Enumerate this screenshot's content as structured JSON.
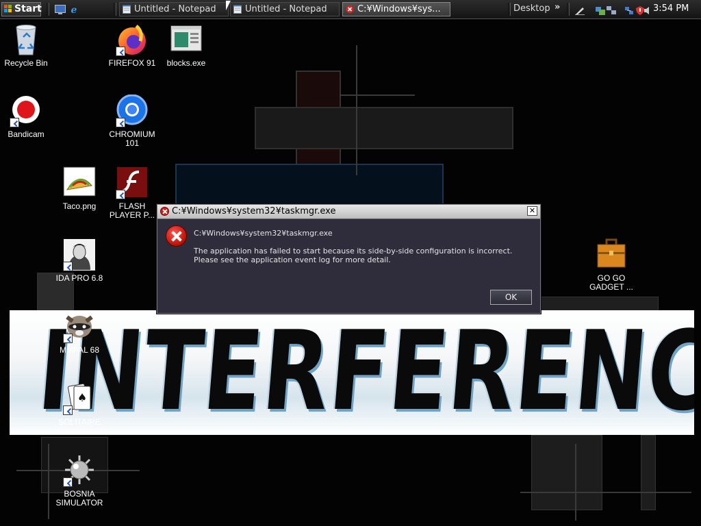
{
  "taskbar": {
    "start_label": "Start",
    "tasks": [
      {
        "label": "Untitled - Notepad",
        "active": false
      },
      {
        "label": "Untitled - Notepad",
        "active": false
      },
      {
        "label": "C:¥Windows¥sys...",
        "active": true
      }
    ],
    "desktop_toolbar_label": "Desktop",
    "chevron": "»",
    "clock": "3:54 PM"
  },
  "desktop": {
    "icons": [
      {
        "label": "Recycle Bin",
        "icon": "recycle-bin-icon"
      },
      {
        "label": "FIREFOX 91",
        "icon": "firefox-icon"
      },
      {
        "label": "blocks.exe",
        "icon": "blocks-exe-icon"
      },
      {
        "label": "Bandicam",
        "icon": "bandicam-icon"
      },
      {
        "label": "CHROMIUM 101",
        "icon": "chromium-icon"
      },
      {
        "label": "Taco.png",
        "icon": "taco-icon"
      },
      {
        "label": "FLASH PLAYER P...",
        "icon": "flash-player-icon"
      },
      {
        "label": "IDA PRO 6.8",
        "icon": "ida-pro-icon"
      },
      {
        "label": "GO GO GADGET ...",
        "icon": "briefcase-icon"
      },
      {
        "label": "MMPAL 68",
        "icon": "raccoon-icon"
      },
      {
        "label": "SOLITAIRE",
        "icon": "cards-icon"
      },
      {
        "label": "BOSNIA SIMULATOR",
        "icon": "mine-icon"
      }
    ],
    "banner_text": "INTERFERENCE"
  },
  "dialog": {
    "title": "C:¥Windows¥system32¥taskmgr.exe",
    "close_label": "✕",
    "heading": "C:¥Windows¥system32¥taskmgr.exe",
    "message_line1": "The application has failed to start because its side-by-side configuration is incorrect.",
    "message_line2": "Please see the application event log for more detail.",
    "ok_label": "OK"
  }
}
